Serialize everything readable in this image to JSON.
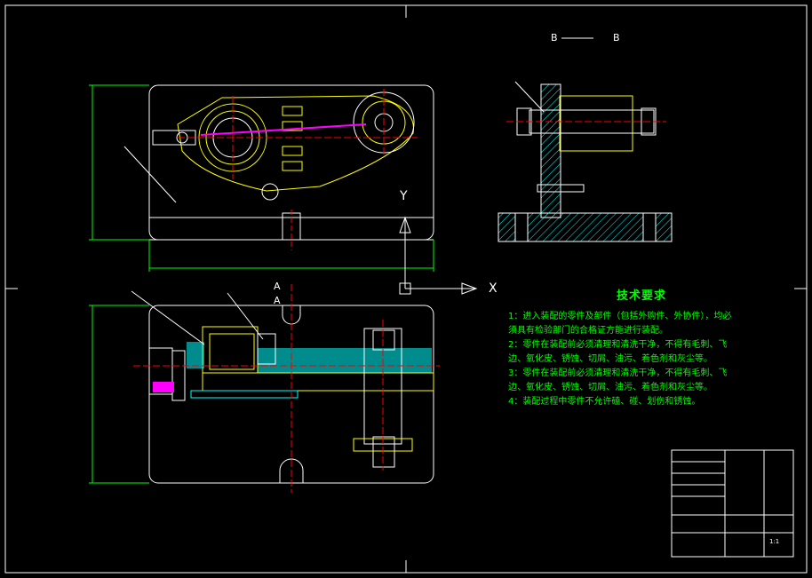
{
  "section_view": {
    "label_left": "B",
    "label_right": "B",
    "cut_label_a1": "A",
    "cut_label_a2": "A"
  },
  "axes": {
    "x_label": "X",
    "y_label": "Y"
  },
  "technical_requirements": {
    "title": "技术要求",
    "lines": [
      "1：进入装配的零件及部件（包括外购件、外协件），均必",
      "须具有检验部门的合格证方能进行装配。",
      "2：零件在装配前必须清理和清洗干净，不得有毛刺、飞",
      "边、氧化皮、锈蚀、切屑、油污、着色剂和灰尘等。",
      "3：零件在装配前必须清理和清洗干净，不得有毛刺、飞",
      "边、氧化皮、锈蚀、切屑、油污、着色剂和灰尘等。",
      "4：装配过程中零件不允许磕、碰、划伤和锈蚀。"
    ]
  },
  "title_block": {
    "scale_text": "1:1"
  },
  "colors": {
    "background": "#000000",
    "outline": "#ffffff",
    "dimension": "#00ff00",
    "centerline": "#ff0000",
    "workpiece": "#ffff00",
    "highlight": "#ff00ff",
    "hatch": "#00ffff"
  }
}
